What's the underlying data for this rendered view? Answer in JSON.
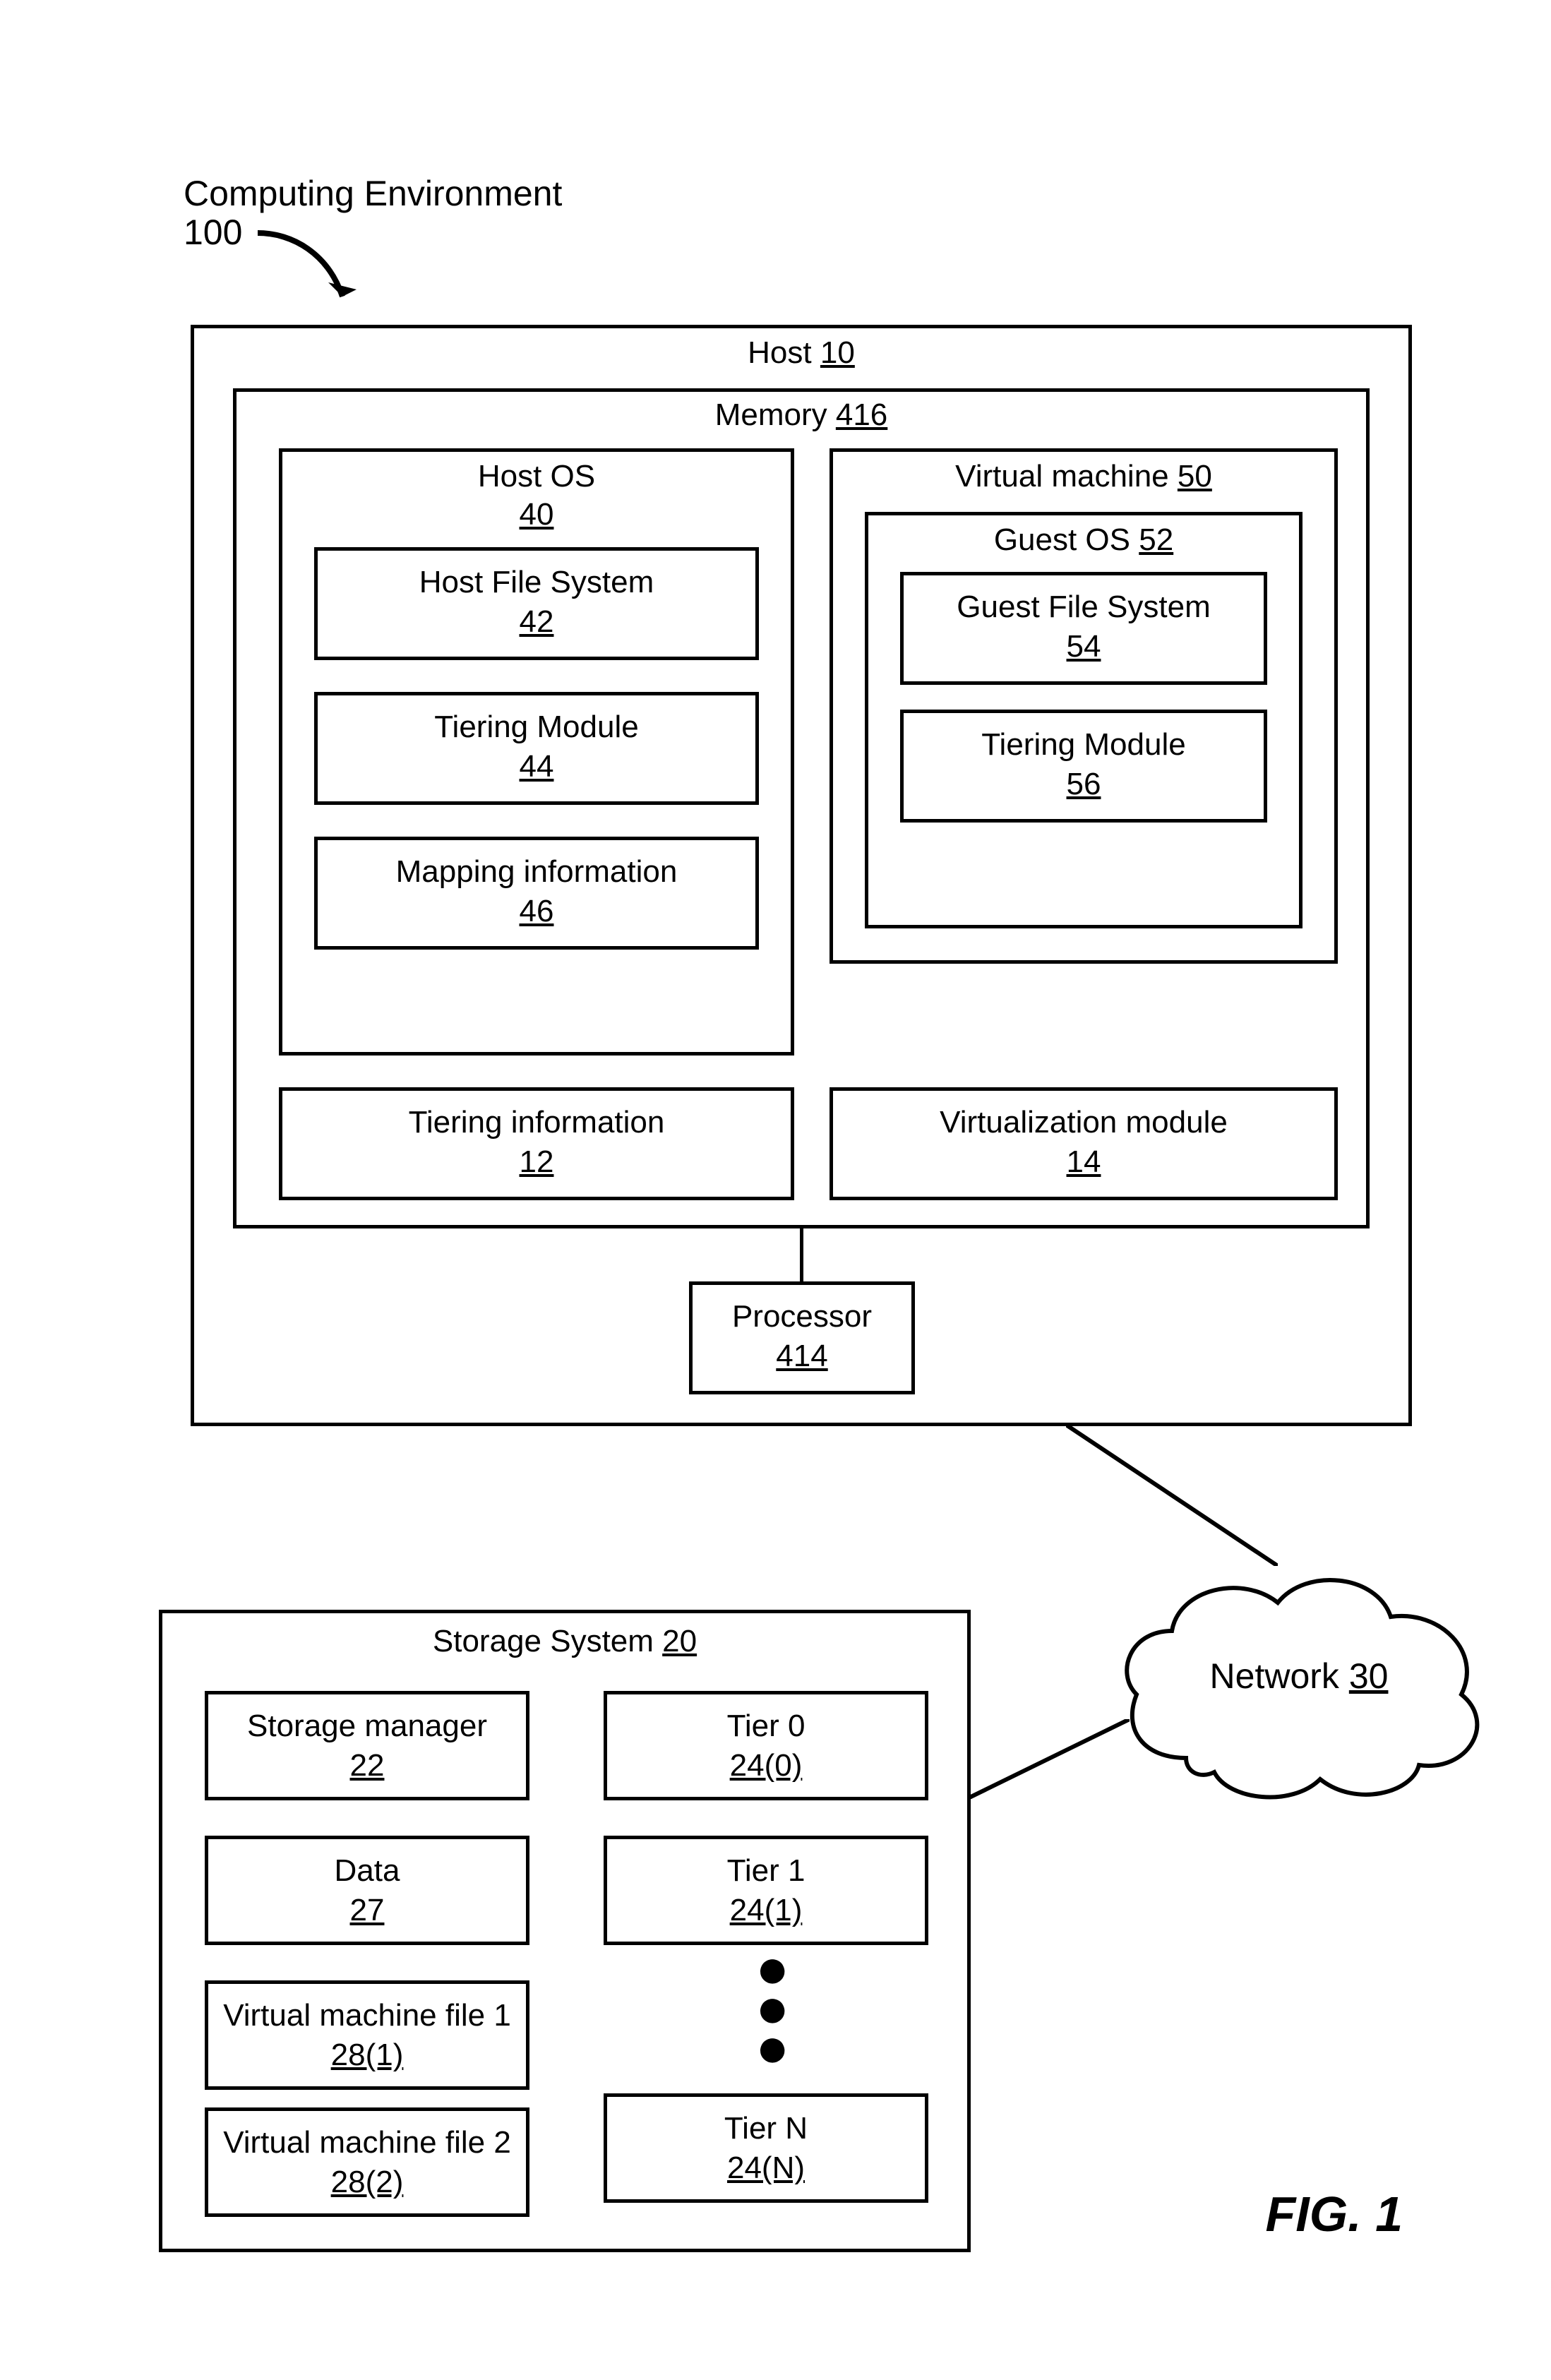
{
  "env": {
    "title": "Computing Environment",
    "num": "100"
  },
  "host": {
    "label": "Host",
    "num": "10"
  },
  "memory": {
    "label": "Memory",
    "num": "416"
  },
  "hostos": {
    "label": "Host OS",
    "num": "40"
  },
  "hfs": {
    "label": "Host File System",
    "num": "42"
  },
  "tm_host": {
    "label": "Tiering Module",
    "num": "44"
  },
  "mapinfo": {
    "label": "Mapping information",
    "num": "46"
  },
  "vm": {
    "label": "Virtual machine",
    "num": "50"
  },
  "guestos": {
    "label": "Guest OS",
    "num": "52"
  },
  "gfs": {
    "label": "Guest File System",
    "num": "54"
  },
  "tm_guest": {
    "label": "Tiering Module",
    "num": "56"
  },
  "tierinfo": {
    "label": "Tiering information",
    "num": "12"
  },
  "virtmod": {
    "label": "Virtualization module",
    "num": "14"
  },
  "processor": {
    "label": "Processor",
    "num": "414"
  },
  "network": {
    "label": "Network",
    "num": "30"
  },
  "storage": {
    "label": "Storage System",
    "num": "20"
  },
  "sm": {
    "label": "Storage manager",
    "num": "22"
  },
  "data": {
    "label": "Data",
    "num": "27"
  },
  "vmf1": {
    "label": "Virtual machine file 1",
    "num": "28(1)"
  },
  "vmf2": {
    "label": "Virtual machine file 2",
    "num": "28(2)"
  },
  "tier0": {
    "label": "Tier 0",
    "num": "24(0)"
  },
  "tier1": {
    "label": "Tier 1",
    "num": "24(1)"
  },
  "tiern": {
    "label": "Tier N",
    "num": "24(N)"
  },
  "figure": "FIG. 1"
}
